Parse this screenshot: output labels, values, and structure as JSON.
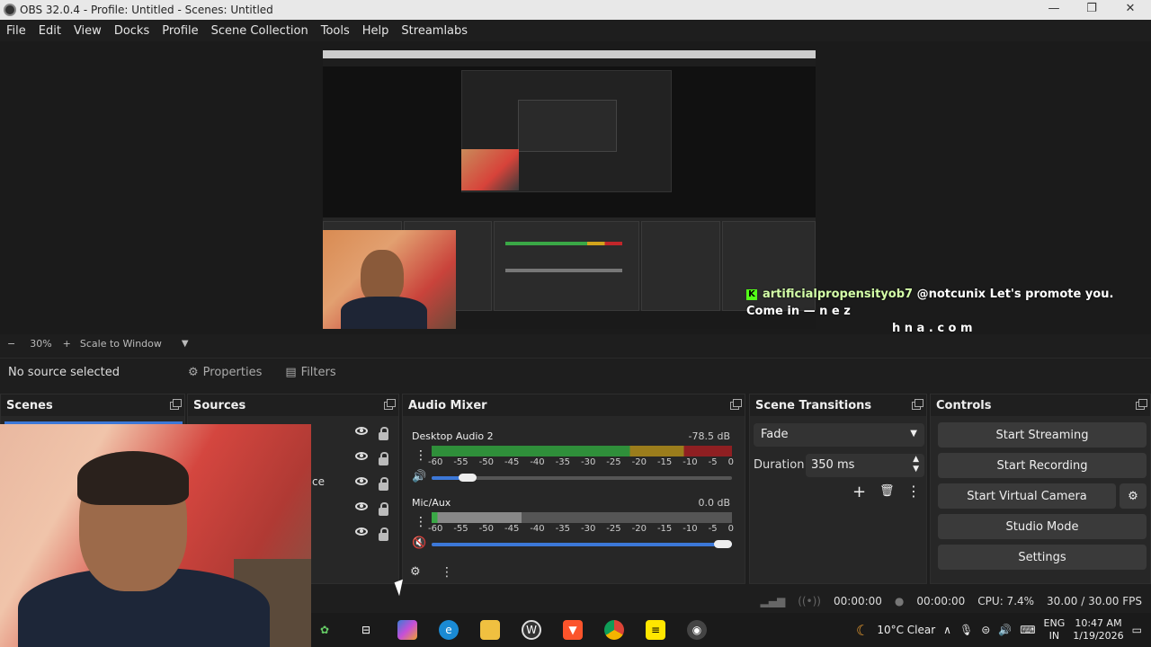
{
  "window": {
    "title": "OBS 32.0.4 - Profile: Untitled - Scenes: Untitled",
    "minimize": "—",
    "restore": "❐",
    "close": "✕"
  },
  "menu": [
    "File",
    "Edit",
    "View",
    "Docks",
    "Profile",
    "Scene Collection",
    "Tools",
    "Help",
    "Streamlabs"
  ],
  "chat": {
    "user": "artificialpropensityob7",
    "message_line1": "@notcunix Let's promote you. Come in — n e z",
    "message_line2": "h n a . c o m"
  },
  "zoom": {
    "minus": "−",
    "value": "30%",
    "plus": "+",
    "scale_label": "Scale to Window"
  },
  "source_bar": {
    "status": "No source selected",
    "properties": "Properties",
    "filters": "Filters"
  },
  "docks": {
    "scenes": {
      "title": "Scenes"
    },
    "sources": {
      "title": "Sources",
      "partial_text": "ce"
    },
    "audio_mixer": {
      "title": "Audio Mixer",
      "channels": [
        {
          "name": "Desktop Audio 2",
          "level": "-78.5 dB",
          "volume": 0.12,
          "muted": false
        },
        {
          "name": "Mic/Aux",
          "level": "0.0 dB",
          "volume": 1.0,
          "muted": true
        }
      ],
      "ticks": [
        "-60",
        "-55",
        "-50",
        "-45",
        "-40",
        "-35",
        "-30",
        "-25",
        "-20",
        "-15",
        "-10",
        "-5",
        "0"
      ]
    },
    "scene_transitions": {
      "title": "Scene Transitions",
      "transition": "Fade",
      "duration_label": "Duration",
      "duration_value": "350 ms"
    },
    "controls": {
      "title": "Controls",
      "start_streaming": "Start Streaming",
      "start_recording": "Start Recording",
      "start_virtual_camera": "Start Virtual Camera",
      "studio_mode": "Studio Mode",
      "settings": "Settings"
    }
  },
  "status": {
    "stream_time": "00:00:00",
    "rec_time": "00:00:00",
    "cpu": "CPU: 7.4%",
    "fps": "30.00 / 30.00 FPS"
  },
  "taskbar": {
    "weather": "10°C  Clear",
    "lang_top": "ENG",
    "lang_bottom": "IN",
    "time": "10:47 AM",
    "date": "1/19/2026"
  },
  "colors": {
    "accent": "#3c78d8",
    "meter_green": "#3aa846",
    "meter_yellow": "#d2a41c",
    "meter_red": "#c2262a",
    "kick_green": "#53fc18"
  }
}
